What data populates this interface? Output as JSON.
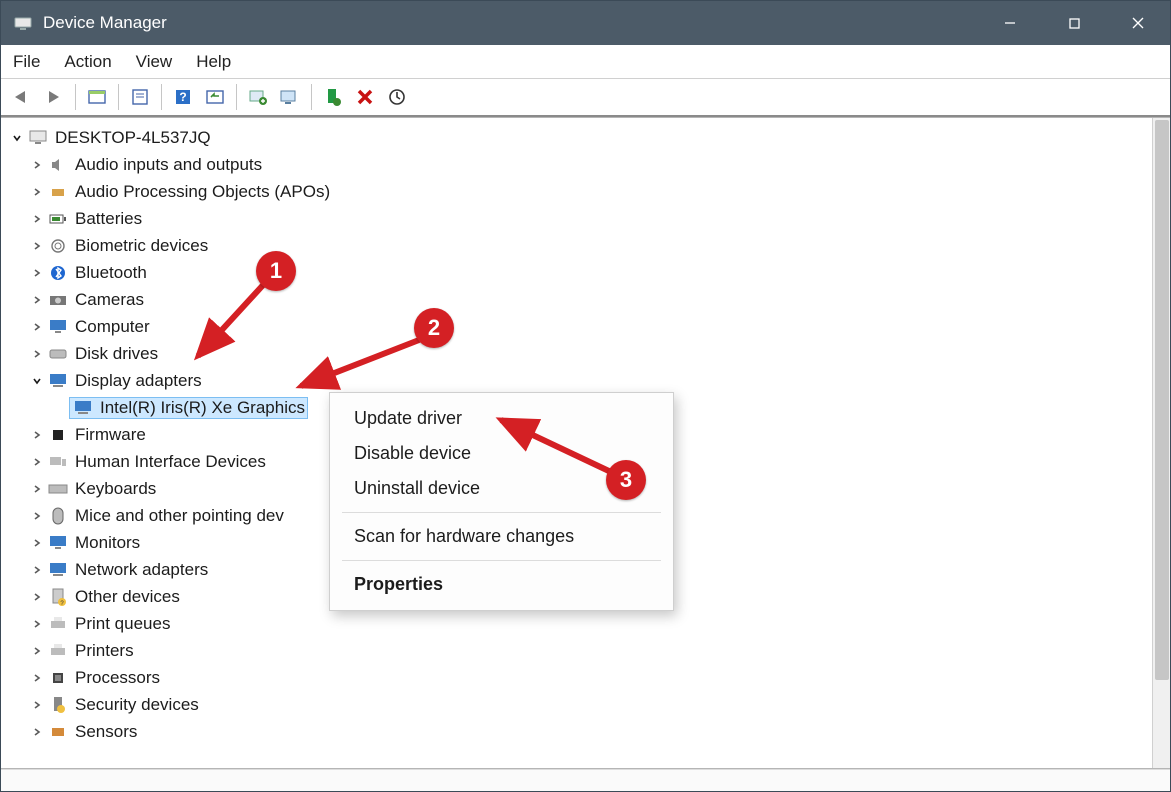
{
  "window": {
    "title": "Device Manager"
  },
  "menubar": [
    "File",
    "Action",
    "View",
    "Help"
  ],
  "toolbar_icons": [
    "back-icon",
    "forward-icon",
    "sep",
    "show-hidden-icon",
    "sep",
    "properties-sheet-icon",
    "sep",
    "help-icon",
    "refresh-icon",
    "sep",
    "update-driver-icon",
    "uninstall-monitor-icon",
    "sep",
    "enable-icon",
    "disable-icon",
    "scan-hardware-icon"
  ],
  "tree": {
    "root": {
      "label": "DESKTOP-4L537JQ",
      "expanded": true,
      "icon": "computer-node-icon"
    },
    "children": [
      {
        "label": "Audio inputs and outputs",
        "icon": "speaker-icon"
      },
      {
        "label": "Audio Processing Objects (APOs)",
        "icon": "apo-icon"
      },
      {
        "label": "Batteries",
        "icon": "battery-icon"
      },
      {
        "label": "Biometric devices",
        "icon": "fingerprint-icon"
      },
      {
        "label": "Bluetooth",
        "icon": "bluetooth-icon"
      },
      {
        "label": "Cameras",
        "icon": "camera-icon"
      },
      {
        "label": "Computer",
        "icon": "monitor-icon"
      },
      {
        "label": "Disk drives",
        "icon": "disk-icon"
      },
      {
        "label": "Display adapters",
        "icon": "display-adapter-icon",
        "expanded": true,
        "child": {
          "label": "Intel(R) Iris(R) Xe Graphics",
          "icon": "display-adapter-icon",
          "selected": true
        }
      },
      {
        "label": "Firmware",
        "icon": "chip-icon"
      },
      {
        "label": "Human Interface Devices",
        "icon": "hid-icon"
      },
      {
        "label": "Keyboards",
        "icon": "keyboard-icon"
      },
      {
        "label": "Mice and other pointing dev",
        "icon": "mouse-icon"
      },
      {
        "label": "Monitors",
        "icon": "monitor2-icon"
      },
      {
        "label": "Network adapters",
        "icon": "network-adapter-icon"
      },
      {
        "label": "Other devices",
        "icon": "other-devices-icon"
      },
      {
        "label": "Print queues",
        "icon": "printer-icon"
      },
      {
        "label": "Printers",
        "icon": "printer-icon"
      },
      {
        "label": "Processors",
        "icon": "processor-icon"
      },
      {
        "label": "Security devices",
        "icon": "security-icon"
      },
      {
        "label": "Sensors",
        "icon": "sensor-icon"
      }
    ]
  },
  "context_menu": {
    "items": [
      {
        "label": "Update driver"
      },
      {
        "label": "Disable device"
      },
      {
        "label": "Uninstall device"
      },
      {
        "sep": true
      },
      {
        "label": "Scan for hardware changes"
      },
      {
        "sep": true
      },
      {
        "label": "Properties",
        "bold": true
      }
    ]
  },
  "annotations": {
    "b1": "1",
    "b2": "2",
    "b3": "3"
  }
}
